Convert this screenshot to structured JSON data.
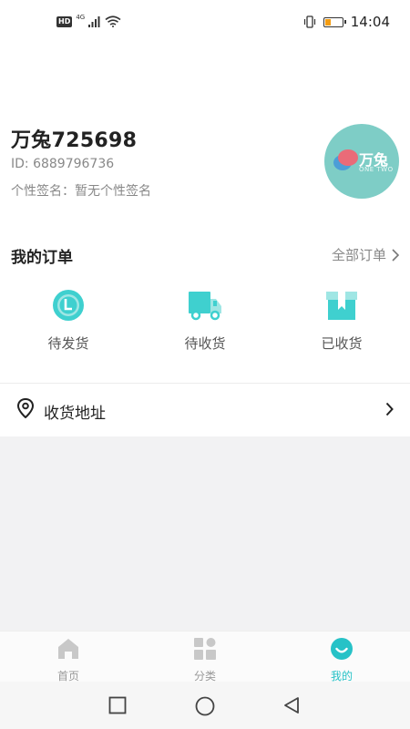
{
  "status_bar": {
    "hd": "HD",
    "network": "4G",
    "time": "14:04",
    "battery_level": 0.3,
    "battery_color": "#f39c12"
  },
  "profile": {
    "username": "万兔725698",
    "user_id": "ID: 6889796736",
    "signature": "个性签名：暂无个性签名",
    "avatar": {
      "text": "万兔",
      "subtext": "ONE TWO",
      "bg_color": "#7ecdc6"
    }
  },
  "orders": {
    "title": "我的订单",
    "all_label": "全部订单",
    "items": [
      {
        "label": "待发货",
        "icon": "clock-icon"
      },
      {
        "label": "待收货",
        "icon": "delivery-truck-icon"
      },
      {
        "label": "已收货",
        "icon": "received-box-icon"
      }
    ],
    "accent_color": "#3fd0cf"
  },
  "address": {
    "label": "收货地址",
    "icon": "location-pin-icon"
  },
  "tab_bar": {
    "tabs": [
      {
        "label": "首页",
        "icon": "home-icon",
        "active": false
      },
      {
        "label": "分类",
        "icon": "category-grid-icon",
        "active": false
      },
      {
        "label": "我的",
        "icon": "profile-face-icon",
        "active": true
      }
    ],
    "active_color": "#27c2c7",
    "inactive_color": "#c8c8c8"
  },
  "system_nav": {
    "buttons": [
      "recent-apps-icon",
      "home-circle-icon",
      "back-triangle-icon"
    ]
  }
}
